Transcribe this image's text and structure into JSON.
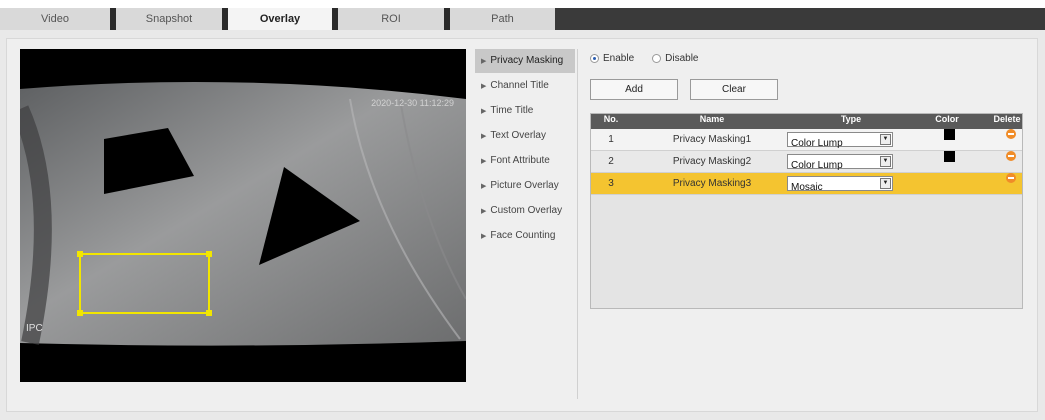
{
  "tabs": [
    {
      "label": "Video",
      "active": false
    },
    {
      "label": "Snapshot",
      "active": false
    },
    {
      "label": "Overlay",
      "active": true
    },
    {
      "label": "ROI",
      "active": false
    },
    {
      "label": "Path",
      "active": false
    }
  ],
  "preview": {
    "timestamp": "2020-12-30 11:12:29",
    "channel_title": "IPC"
  },
  "subnav": {
    "items": [
      {
        "label": "Privacy Masking",
        "active": true
      },
      {
        "label": "Channel Title",
        "active": false
      },
      {
        "label": "Time Title",
        "active": false
      },
      {
        "label": "Text Overlay",
        "active": false
      },
      {
        "label": "Font Attribute",
        "active": false
      },
      {
        "label": "Picture Overlay",
        "active": false
      },
      {
        "label": "Custom Overlay",
        "active": false
      },
      {
        "label": "Face Counting",
        "active": false
      }
    ]
  },
  "privacy": {
    "enable_label": "Enable",
    "disable_label": "Disable",
    "enabled": true,
    "add_label": "Add",
    "clear_label": "Clear",
    "columns": [
      "No.",
      "Name",
      "Type",
      "Color",
      "Delete"
    ],
    "rows": [
      {
        "no": "1",
        "name": "Privacy Masking1",
        "type": "Color Lump",
        "color": "#000000",
        "selected": false
      },
      {
        "no": "2",
        "name": "Privacy Masking2",
        "type": "Color Lump",
        "color": "#000000",
        "selected": false
      },
      {
        "no": "3",
        "name": "Privacy Masking3",
        "type": "Mosaic",
        "color": null,
        "selected": true
      }
    ]
  },
  "colors": {
    "selected_row": "#f4c430",
    "delete_icon": "#f08c28",
    "mask_outline": "#f2e600",
    "header": "#5a5a5a"
  }
}
